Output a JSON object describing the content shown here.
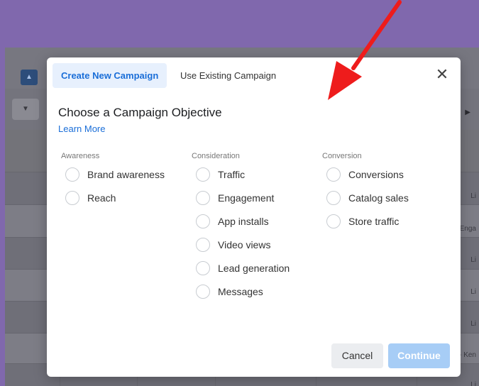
{
  "background_app": {
    "row_text": [
      "Li",
      "Enga",
      "Li",
      "Li",
      "Li",
      "- Ken",
      "Li"
    ]
  },
  "tabs": {
    "create_new": "Create New Campaign",
    "use_existing": "Use Existing Campaign"
  },
  "modal": {
    "title": "Choose a Campaign Objective",
    "learn_more": "Learn More"
  },
  "columns": [
    {
      "heading": "Awareness",
      "options": [
        "Brand awareness",
        "Reach"
      ]
    },
    {
      "heading": "Consideration",
      "options": [
        "Traffic",
        "Engagement",
        "App installs",
        "Video views",
        "Lead generation",
        "Messages"
      ]
    },
    {
      "heading": "Conversion",
      "options": [
        "Conversions",
        "Catalog sales",
        "Store traffic"
      ]
    }
  ],
  "buttons": {
    "cancel": "Cancel",
    "continue": "Continue"
  },
  "colors": {
    "accent": "#1a6ed8",
    "continue_disabled": "#a7cdf6",
    "arrow": "#ee1c1c",
    "page_background": "#8068ad"
  },
  "icons": {
    "close": "close-icon",
    "arrow": "annotation-arrow-icon"
  }
}
